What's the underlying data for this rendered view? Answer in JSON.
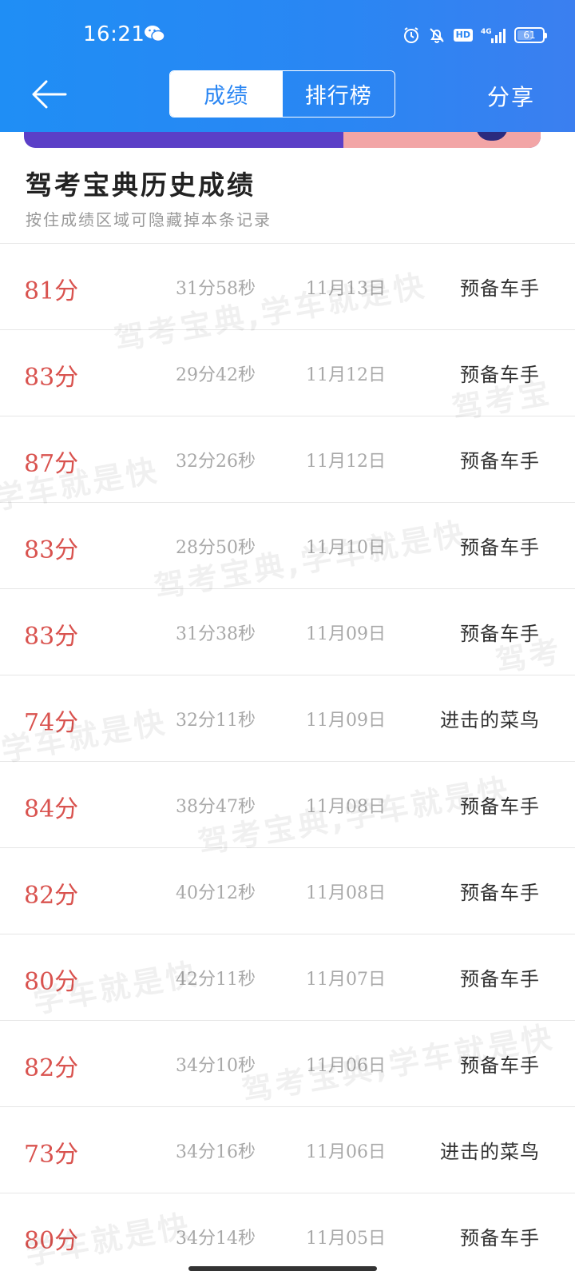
{
  "status_bar": {
    "time": "16:21",
    "battery": "61",
    "battery_level": 0.61,
    "network": "4G",
    "hd": "HD",
    "icons": [
      "wechat-icon",
      "alarm-icon",
      "bell-off-icon",
      "hd-icon",
      "signal-icon",
      "battery-icon"
    ]
  },
  "header": {
    "tabs": [
      {
        "label": "成绩",
        "active": true
      },
      {
        "label": "排行榜",
        "active": false
      }
    ],
    "share_label": "分享",
    "colors": {
      "bar": "#2a86f3",
      "accent_text": "#2a86f3"
    }
  },
  "section": {
    "title": "驾考宝典历史成绩",
    "subtitle": "按住成绩区域可隐藏掉本条记录"
  },
  "records": [
    {
      "score": "81分",
      "duration": "31分58秒",
      "date": "11月13日",
      "level": "预备车手"
    },
    {
      "score": "83分",
      "duration": "29分42秒",
      "date": "11月12日",
      "level": "预备车手"
    },
    {
      "score": "87分",
      "duration": "32分26秒",
      "date": "11月12日",
      "level": "预备车手"
    },
    {
      "score": "83分",
      "duration": "28分50秒",
      "date": "11月10日",
      "level": "预备车手"
    },
    {
      "score": "83分",
      "duration": "31分38秒",
      "date": "11月09日",
      "level": "预备车手"
    },
    {
      "score": "74分",
      "duration": "32分11秒",
      "date": "11月09日",
      "level": "进击的菜鸟"
    },
    {
      "score": "84分",
      "duration": "38分47秒",
      "date": "11月08日",
      "level": "预备车手"
    },
    {
      "score": "82分",
      "duration": "40分12秒",
      "date": "11月08日",
      "level": "预备车手"
    },
    {
      "score": "80分",
      "duration": "42分11秒",
      "date": "11月07日",
      "level": "预备车手"
    },
    {
      "score": "82分",
      "duration": "34分10秒",
      "date": "11月06日",
      "level": "预备车手"
    },
    {
      "score": "73分",
      "duration": "34分16秒",
      "date": "11月06日",
      "level": "进击的菜鸟"
    },
    {
      "score": "80分",
      "duration": "34分14秒",
      "date": "11月05日",
      "level": "预备车手"
    }
  ],
  "watermark_text": [
    "驾考宝典,学车就是快",
    "学车就是快",
    "驾考宝",
    "驾考"
  ],
  "colors": {
    "score": "#d9534f",
    "secondary_text": "#a8a8a8",
    "divider": "#e6e6e6"
  }
}
